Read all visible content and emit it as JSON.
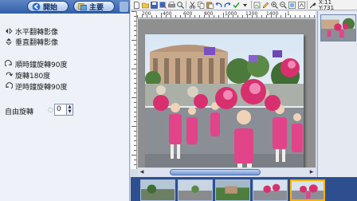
{
  "nav": {
    "start_label": "開始",
    "main_label": "主要"
  },
  "menu": {
    "hflip": "水平翻轉影像",
    "vflip": "垂直翻轉影像",
    "cw90": "順時鐘旋轉90度",
    "rot180": "旋轉180度",
    "ccw90": "逆時鐘旋轉90度",
    "free_rotate": "自由旋轉"
  },
  "rotate_value": "0",
  "coords": {
    "x": "X:11",
    "y": "Y:731"
  },
  "ruler_top": [
    "200",
    "400",
    "600",
    "800",
    "1000",
    "1200",
    "1400",
    "1"
  ],
  "ruler_left": [
    "200",
    "400",
    "600",
    "800",
    "1000"
  ],
  "toolbar_icons": [
    "new-icon",
    "open-icon",
    "save-icon",
    "save-as-icon",
    "print-icon",
    "zoom-icon",
    "cut-icon",
    "copy-icon",
    "paste-icon",
    "undo-icon",
    "redo-icon",
    "confirm-icon",
    "crop-icon",
    "pen-icon",
    "zoom-in-icon",
    "zoom-out-icon",
    "fit-icon",
    "eyedropper-icon"
  ],
  "colors": {
    "nav_bar": "#2f5ea8",
    "filmstrip": "#2e4f8f",
    "selected_thumb": "#ffb200"
  }
}
